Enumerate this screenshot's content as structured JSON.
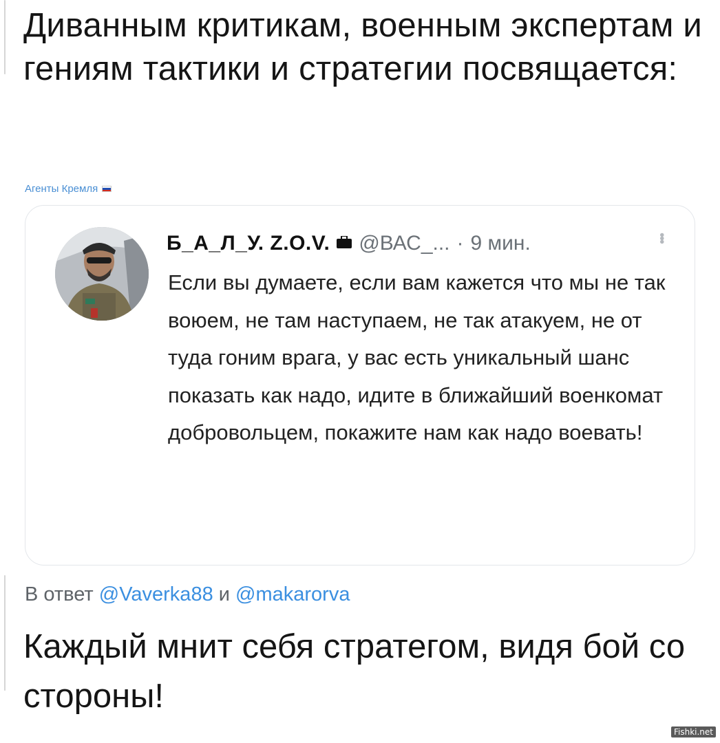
{
  "post": {
    "text_top": "Диванным критикам, военным экспертам и гениям тактики и стратегии посвящается:",
    "source_label": "Агенты Кремля",
    "source_flag_colors": [
      "#ffffff",
      "#1f4fb5",
      "#d52b1e"
    ]
  },
  "quoted_tweet": {
    "author_name": "Б_А_Л_У. Z.O.V.",
    "briefcase_icon": "briefcase-icon",
    "handle": "@ВАС_...",
    "separator": "·",
    "time": "9 мин.",
    "more_icon": "more-vertical-icon",
    "body": "Если вы думаете, если вам кажется что мы не так воюем, не там наступаем, не так атакуем, не от туда гоним врага, у вас есть уникальный шанс показать как надо, идите в ближайший военкомат добровольцем, покажите нам как надо воевать!"
  },
  "reply": {
    "prefix": "В ответ",
    "mention_1": "@Vaverka88",
    "conjunction": "и",
    "mention_2": "@makarorva",
    "text": "Каждый мнит себя стратегом, видя бой со стороны!"
  },
  "watermark": "Fishki.net",
  "colors": {
    "link": "#3b8fe0",
    "source": "#4a8fd4",
    "muted": "#6b7177",
    "border": "#e3e6ea"
  }
}
